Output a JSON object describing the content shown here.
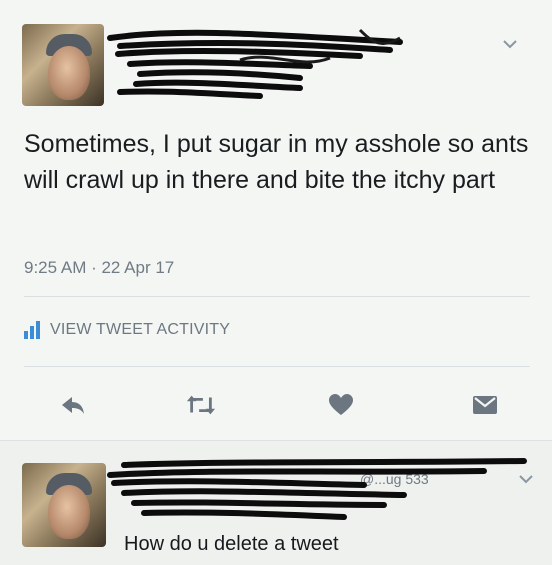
{
  "tweet": {
    "text": "Sometimes, I put sugar in my asshole so ants will crawl up in there and bite the itchy part",
    "timestamp": "9:25 AM · 22 Apr 17",
    "activity_label": "VIEW TWEET ACTIVITY"
  },
  "actions": {
    "icons": [
      "reply-icon",
      "retweet-icon",
      "like-icon",
      "message-icon"
    ]
  },
  "reply": {
    "text": "How do u delete a tweet",
    "partial_handle_text": "@...ug  533"
  },
  "colors": {
    "accent": "#3b8ed6",
    "muted": "#707b84",
    "text": "#1a1d20"
  }
}
